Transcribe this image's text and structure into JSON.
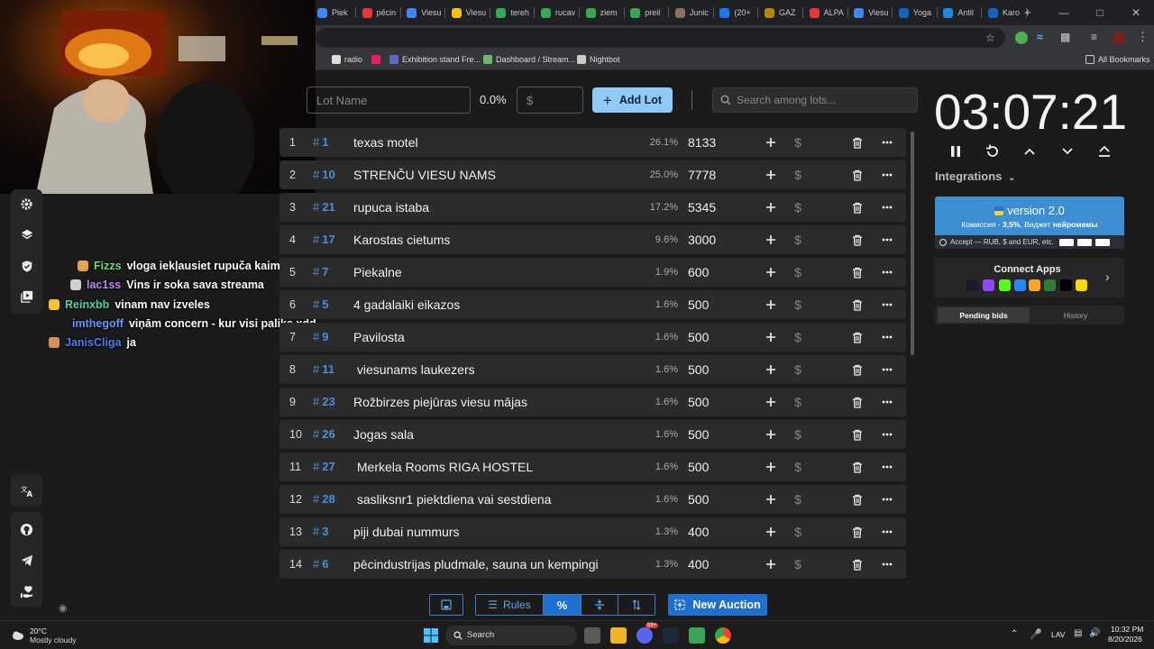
{
  "browser": {
    "tabs": [
      {
        "label": "Piek",
        "color": "#4285f4"
      },
      {
        "label": "pēcin",
        "color": "#e53935"
      },
      {
        "label": "Viesu",
        "color": "#4285f4"
      },
      {
        "label": "Viesu",
        "color": "#f4c20d"
      },
      {
        "label": "tereh",
        "color": "#34a853"
      },
      {
        "label": "rucav",
        "color": "#34a853"
      },
      {
        "label": "ziem",
        "color": "#34a853"
      },
      {
        "label": "preil",
        "color": "#34a853"
      },
      {
        "label": "Junic",
        "color": "#8d6e63"
      },
      {
        "label": "(20+",
        "color": "#1877f2"
      },
      {
        "label": "GAZ",
        "color": "#b8860b"
      },
      {
        "label": "ALPA",
        "color": "#e53935"
      },
      {
        "label": "Viesu",
        "color": "#4285f4"
      },
      {
        "label": "Yoga",
        "color": "#1565c0"
      },
      {
        "label": "Antil",
        "color": "#1e88e5"
      },
      {
        "label": "Karo",
        "color": "#1565c0"
      }
    ],
    "new_tab": "+",
    "bookmarks": [
      {
        "label": "radio",
        "color": "#dddddd"
      },
      {
        "label": "",
        "color": "#e91e63"
      },
      {
        "label": "Exhibition stand Fre...",
        "color": "#5c6bc0"
      },
      {
        "label": "Dashboard / Stream...",
        "color": "#66bb6a"
      },
      {
        "label": "Nightbot",
        "color": "#cccccc"
      }
    ],
    "all_bookmarks": "All Bookmarks"
  },
  "chat": [
    {
      "user": "Fizzs",
      "user_color": "#6ce06c",
      "message": "vloga iekļausiet rupuča kaimiņus ?",
      "badge_color": "#e0a84a"
    },
    {
      "user": "lac1ss",
      "user_color": "#b98ef0",
      "message": "Vins ir soka sava streama",
      "badge_color": "#cfcfcf"
    },
    {
      "user": "Reinxbb",
      "user_color": "#4ed6a5",
      "message": "vinam nav izveles",
      "badge_color": "#f2c230"
    },
    {
      "user": "imthegoff",
      "user_color": "#5b9bff",
      "message": "viņām concern - kur visi paliks xdd",
      "badge_color": ""
    },
    {
      "user": "JanisCliga",
      "user_color": "#4d7ff0",
      "message": "ja",
      "badge_color": "#d4905a"
    }
  ],
  "header": {
    "lot_name_placeholder": "Lot Name",
    "percent": "0.0%",
    "amount_placeholder": "$",
    "add_lot": "Add Lot",
    "search_placeholder": "Search among lots..."
  },
  "lots": [
    {
      "index": "1",
      "number": "1",
      "name": "texas motel",
      "percent": "26.1%",
      "amount": "8133"
    },
    {
      "index": "2",
      "number": "10",
      "name": "STRENČU VIESU NAMS",
      "percent": "25.0%",
      "amount": "7778"
    },
    {
      "index": "3",
      "number": "21",
      "name": "rupuca istaba",
      "percent": "17.2%",
      "amount": "5345"
    },
    {
      "index": "4",
      "number": "17",
      "name": "Karostas cietums",
      "percent": "9.6%",
      "amount": "3000"
    },
    {
      "index": "5",
      "number": "7",
      "name": "Piekalne",
      "percent": "1.9%",
      "amount": "600"
    },
    {
      "index": "6",
      "number": "5",
      "name": "4 gadalaiki eikazos",
      "percent": "1.6%",
      "amount": "500"
    },
    {
      "index": "7",
      "number": "9",
      "name": "Pavilosta",
      "percent": "1.6%",
      "amount": "500"
    },
    {
      "index": "8",
      "number": "11",
      "name": " viesunams laukezers",
      "percent": "1.6%",
      "amount": "500"
    },
    {
      "index": "9",
      "number": "23",
      "name": "Rožbirzes piejūras viesu mājas",
      "percent": "1.6%",
      "amount": "500"
    },
    {
      "index": "10",
      "number": "26",
      "name": "Jogas sala",
      "percent": "1.6%",
      "amount": "500"
    },
    {
      "index": "11",
      "number": "27",
      "name": " Merkela Rooms RIGA HOSTEL",
      "percent": "1.6%",
      "amount": "500"
    },
    {
      "index": "12",
      "number": "28",
      "name": " sasliksnr1 piektdiena vai sestdiena",
      "percent": "1.6%",
      "amount": "500"
    },
    {
      "index": "13",
      "number": "3",
      "name": "piji dubai nummurs",
      "percent": "1.3%",
      "amount": "400"
    },
    {
      "index": "14",
      "number": "6",
      "name": "pēcindustrijas pludmale, sauna un kempingi",
      "percent": "1.3%",
      "amount": "400"
    }
  ],
  "toolbar": {
    "rules": "Rules",
    "percent_symbol": "%",
    "new_auction": "New Auction"
  },
  "timer": {
    "display": "03:07:21"
  },
  "integrations": {
    "label": "Integrations",
    "version_title": "version 2.0",
    "version_sub_prefix": "Комиссия - ",
    "version_sub_bold": "3,5%",
    "version_sub_mid": ", Виджет ",
    "version_sub_bold2": "нейромемы",
    "version_foot": "Accept — RUB, $ and EUR, etc.",
    "connect_title": "Connect Apps",
    "pending_bids": "Pending bids",
    "history": "History"
  },
  "taskbar": {
    "temp": "20°C",
    "weather": "Mostly cloudy",
    "search": "Search",
    "lang": "LAV",
    "time": "10:32 PM",
    "date": "8/20/2026",
    "badge": "99+"
  }
}
